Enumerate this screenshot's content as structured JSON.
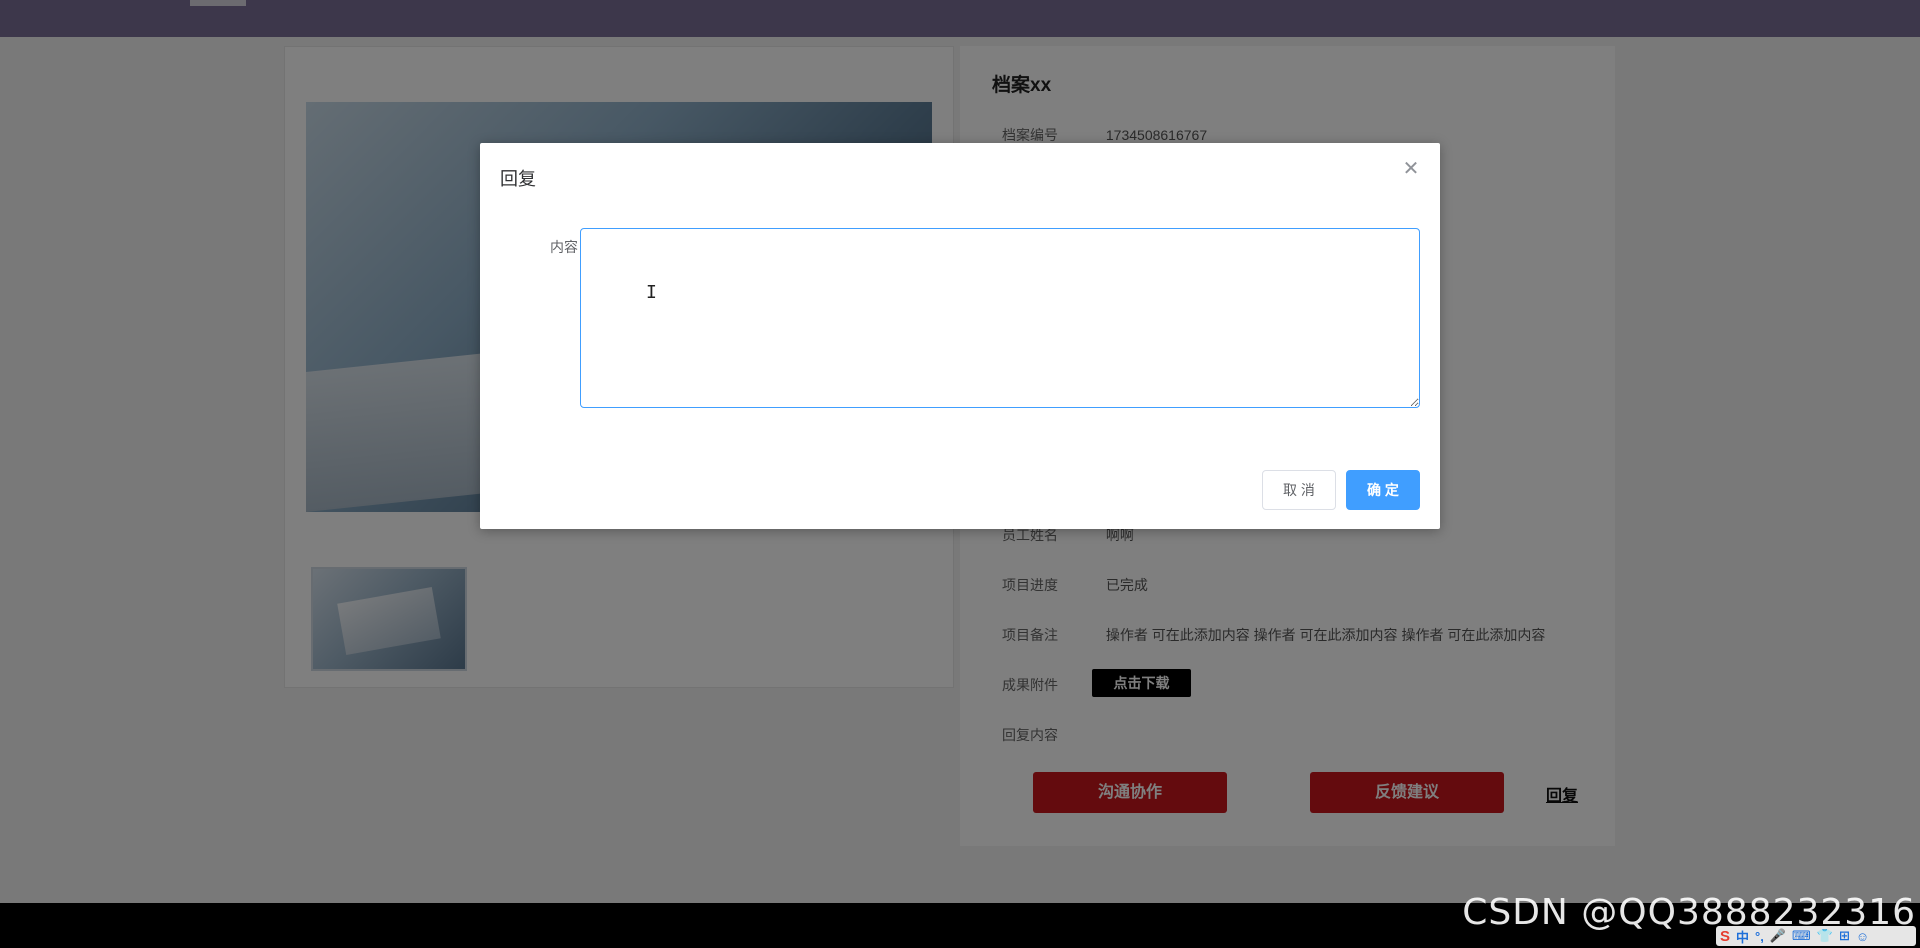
{
  "detail": {
    "title": "档案xx",
    "rows": [
      {
        "label": "档案编号",
        "value": "1734508616767"
      },
      {
        "label": "员工姓名",
        "value": "啊啊"
      },
      {
        "label": "项目进度",
        "value": "已完成"
      },
      {
        "label": "项目备注",
        "value": "操作者 可在此添加内容 操作者 可在此添加内容 操作者 可在此添加内容"
      },
      {
        "label": "成果附件",
        "value": ""
      },
      {
        "label": "回复内容",
        "value": ""
      }
    ],
    "download_label": "点击下载",
    "btn_communicate": "沟通协作",
    "btn_feedback": "反馈建议",
    "reply_link": "回复"
  },
  "dialog": {
    "title": "回复",
    "close_icon": "close-icon",
    "content_label": "内容",
    "content_value": "",
    "content_placeholder": "",
    "cancel_label": "取 消",
    "ok_label": "确 定",
    "accent_color": "#409eff"
  },
  "watermark": "CSDN @QQ3888232316",
  "ime": {
    "s": "S",
    "items": [
      "中",
      "°,",
      "🎤",
      "⌨",
      "👕",
      "⊞",
      "☺"
    ]
  }
}
